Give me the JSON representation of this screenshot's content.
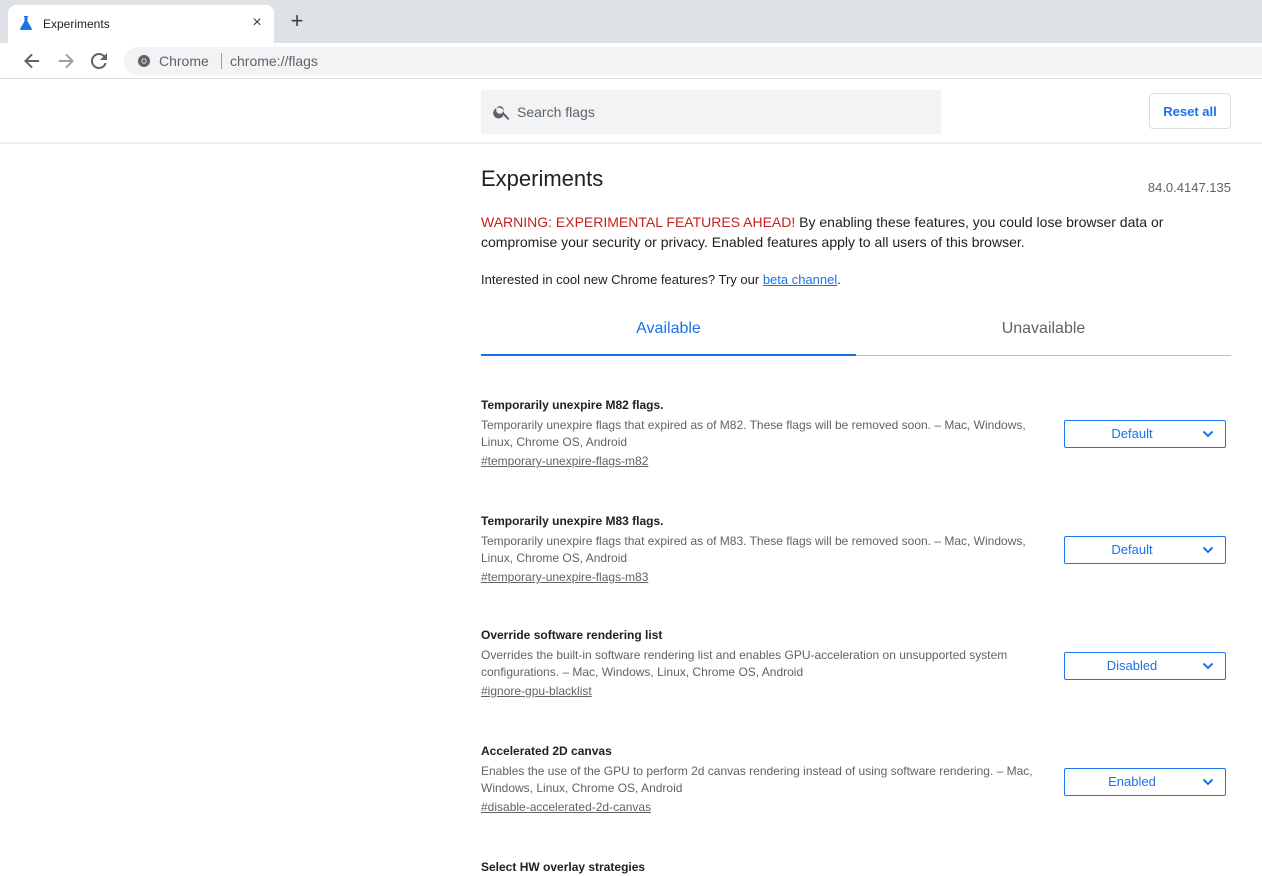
{
  "browser": {
    "tab_title": "Experiments",
    "tab_close_glyph": "×",
    "new_tab_glyph": "+",
    "omnibox_chip": "Chrome",
    "omnibox_url": "chrome://flags",
    "icons": [
      "flask-icon",
      "back-arrow-icon",
      "forward-arrow-icon",
      "reload-icon",
      "chrome-logo-icon"
    ]
  },
  "header": {
    "search_placeholder": "Search flags",
    "reset_label": "Reset all"
  },
  "page": {
    "title": "Experiments",
    "version": "84.0.4147.135",
    "warning_prefix": "WARNING: EXPERIMENTAL FEATURES AHEAD!",
    "warning_text": " By enabling these features, you could lose browser data or compromise your security or privacy. Enabled features apply to all users of this browser.",
    "promo_text": "Interested in cool new Chrome features? Try our ",
    "promo_link": "beta channel",
    "promo_suffix": "."
  },
  "tabs": {
    "available": "Available",
    "unavailable": "Unavailable"
  },
  "experiments": [
    {
      "name": "Temporarily unexpire M82 flags.",
      "description": "Temporarily unexpire flags that expired as of M82. These flags will be removed soon. – Mac, Windows, Linux, Chrome OS, Android",
      "link": "#temporary-unexpire-flags-m82",
      "value": "Default"
    },
    {
      "name": "Temporarily unexpire M83 flags.",
      "description": "Temporarily unexpire flags that expired as of M83. These flags will be removed soon. – Mac, Windows, Linux, Chrome OS, Android",
      "link": "#temporary-unexpire-flags-m83",
      "value": "Default"
    },
    {
      "name": "Override software rendering list",
      "description": "Overrides the built-in software rendering list and enables GPU-acceleration on unsupported system configurations. – Mac, Windows, Linux, Chrome OS, Android",
      "link": "#ignore-gpu-blacklist",
      "value": "Disabled"
    },
    {
      "name": "Accelerated 2D canvas",
      "description": "Enables the use of the GPU to perform 2d canvas rendering instead of using software rendering. – Mac, Windows, Linux, Chrome OS, Android",
      "link": "#disable-accelerated-2d-canvas",
      "value": "Enabled"
    },
    {
      "name": "Select HW overlay strategies"
    }
  ],
  "colors": {
    "accent": "#1a73e8",
    "warning": "#c5221f",
    "tabstrip": "#dee1e6"
  }
}
